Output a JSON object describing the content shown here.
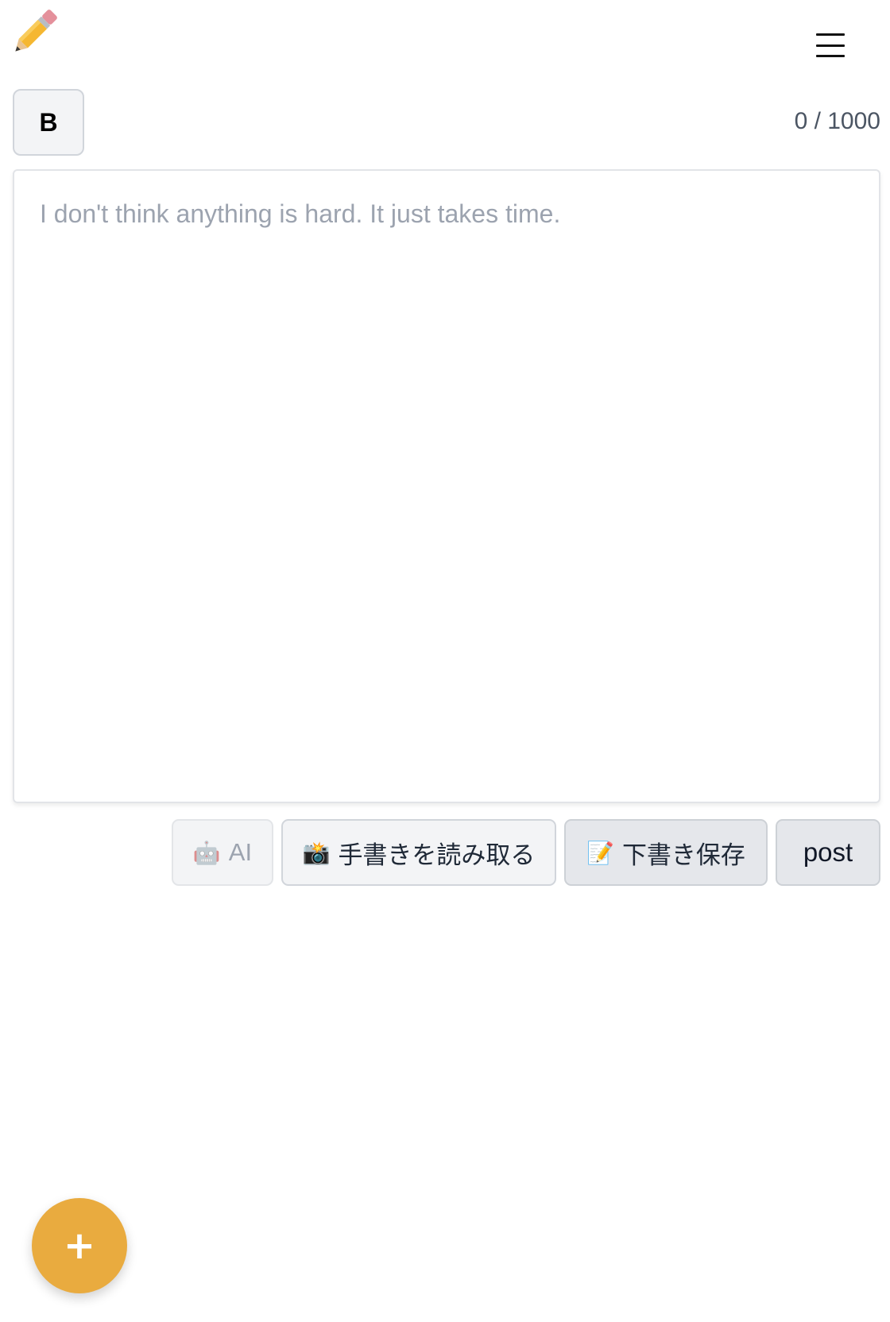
{
  "header": {
    "logo_icon": "pencil-icon",
    "menu_icon": "hamburger-menu-icon"
  },
  "toolbar": {
    "bold_label": "B",
    "char_count": "0 / 1000"
  },
  "editor": {
    "value": "",
    "placeholder": "I don't think anything is hard. It just takes time."
  },
  "actions": {
    "ai": {
      "icon": "robot-icon",
      "glyph": "🤖",
      "label": "AI"
    },
    "scan": {
      "icon": "camera-flash-icon",
      "glyph": "📸",
      "label": "手書きを読み取る"
    },
    "draft": {
      "icon": "memo-icon",
      "glyph": "📝",
      "label": "下書き保存"
    },
    "post": {
      "label": "post"
    }
  },
  "fab": {
    "icon": "plus-icon",
    "label": "+"
  },
  "colors": {
    "fab": "#e9ab3f",
    "button_bg": "#f3f4f6",
    "placeholder": "#9ca3af"
  }
}
